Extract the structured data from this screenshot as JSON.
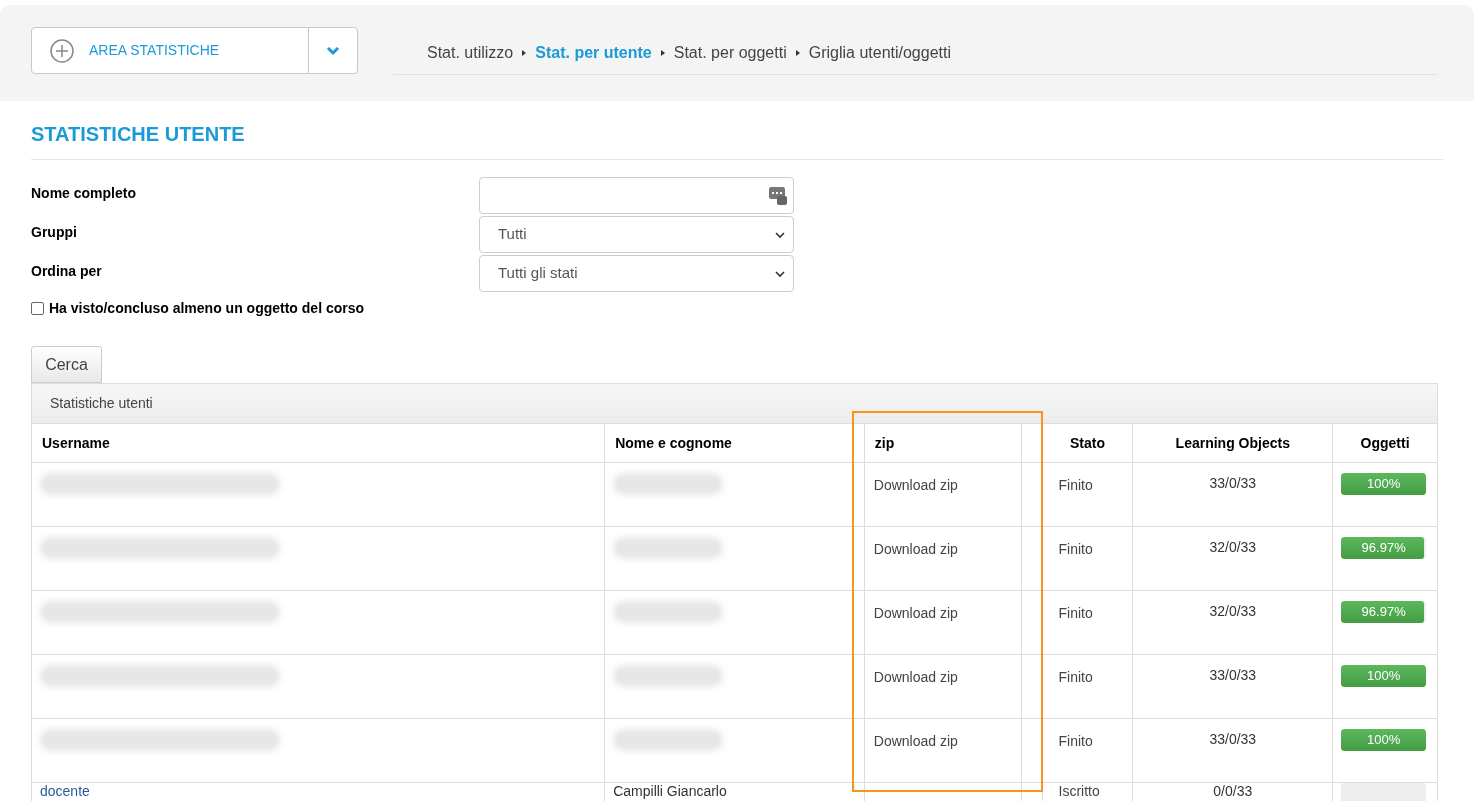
{
  "area_menu": {
    "label": "AREA STATISTICHE"
  },
  "breadcrumb": [
    {
      "label": "Stat. utilizzo",
      "selected": false
    },
    {
      "label": "Stat. per utente",
      "selected": true
    },
    {
      "label": "Stat. per oggetti",
      "selected": false
    },
    {
      "label": "Griglia utenti/oggetti",
      "selected": false
    }
  ],
  "title": "STATISTICHE UTENTE",
  "form": {
    "fields": [
      {
        "label": "Nome completo",
        "kind": "text"
      },
      {
        "label": "Gruppi",
        "kind": "select",
        "value": "Tutti"
      },
      {
        "label": "Ordina per",
        "kind": "select",
        "value": "Tutti gli stati"
      }
    ],
    "checkbox": {
      "label": "Ha visto/concluso almeno un oggetto del corso",
      "checked": false
    },
    "search_button": "Cerca"
  },
  "table": {
    "caption": "Statistiche utenti",
    "columns": [
      "Username",
      "Nome e cognome",
      "zip",
      "Stato",
      "Learning Objects",
      "Oggetti"
    ],
    "highlighted_column": true,
    "rows": [
      {
        "username_blurred": true,
        "name_blurred": true,
        "zip": "Download zip",
        "stato": "Finito",
        "learning_objects": "33/0/33",
        "progress": "100%",
        "level": 1
      },
      {
        "username_blurred": true,
        "name_blurred": true,
        "zip": "Download zip",
        "stato": "Finito",
        "learning_objects": "32/0/33",
        "progress": "96.97%",
        "level": 0.9697
      },
      {
        "username_blurred": true,
        "name_blurred": true,
        "zip": "Download zip",
        "stato": "Finito",
        "learning_objects": "32/0/33",
        "progress": "96.97%",
        "level": 0.9697
      },
      {
        "username_blurred": true,
        "name_blurred": true,
        "zip": "Download zip",
        "stato": "Finito",
        "learning_objects": "33/0/33",
        "progress": "100%",
        "level": 1
      },
      {
        "username_blurred": true,
        "name_blurred": true,
        "zip": "Download zip",
        "stato": "Finito",
        "learning_objects": "33/0/33",
        "progress": "100%",
        "level": 1
      },
      {
        "username": "docente",
        "name": "Campilli Giancarlo",
        "stato": "Iscritto",
        "learning_objects": "0/0/33",
        "level": 0
      }
    ]
  }
}
